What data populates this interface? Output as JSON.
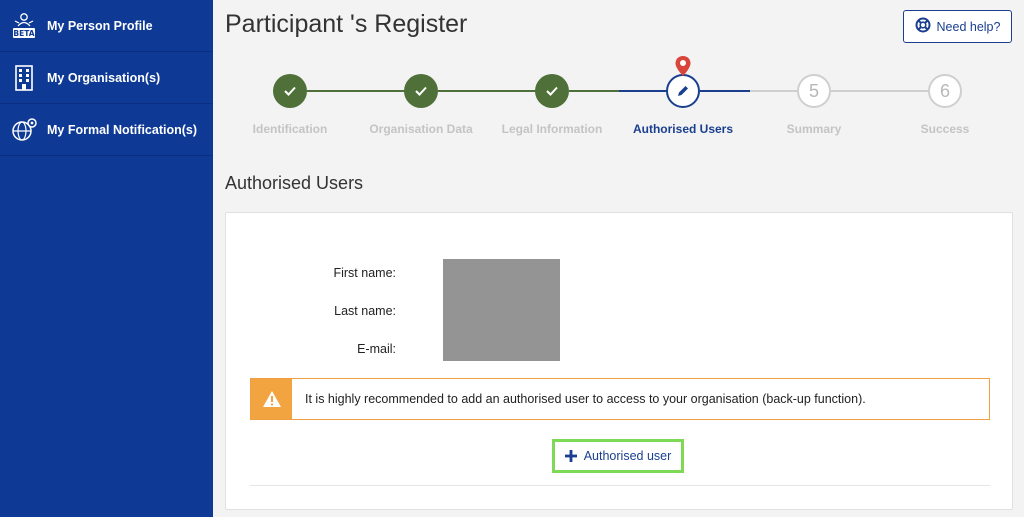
{
  "sidebar": {
    "items": [
      {
        "label": "My Person Profile",
        "icon": "beta-profile-icon",
        "badge": "BETA"
      },
      {
        "label": "My Organisation(s)",
        "icon": "building-icon"
      },
      {
        "label": "My Formal Notification(s)",
        "icon": "globe-gear-icon"
      }
    ]
  },
  "header": {
    "title": "Participant 's Register",
    "help_label": "Need help?"
  },
  "stepper": {
    "steps": [
      {
        "label": "Identification",
        "status": "done"
      },
      {
        "label": "Organisation Data",
        "status": "done"
      },
      {
        "label": "Legal Information",
        "status": "done"
      },
      {
        "label": "Authorised Users",
        "status": "active"
      },
      {
        "label": "Summary",
        "status": "todo",
        "number": "5"
      },
      {
        "label": "Success",
        "status": "todo",
        "number": "6"
      }
    ]
  },
  "section": {
    "title": "Authorised Users"
  },
  "form": {
    "first_name_label": "First name:",
    "last_name_label": "Last name:",
    "email_label": "E-mail:"
  },
  "alert": {
    "text": "It is highly recommended to add an authorised user to access to your organisation (back-up function)."
  },
  "actions": {
    "add_user_label": "Authorised user"
  },
  "colors": {
    "sidebar": "#0e3a96",
    "primary": "#1b3f8f",
    "done": "#4f7038",
    "warning": "#f2a441",
    "highlight": "#7ed957",
    "pin": "#d9443b"
  }
}
